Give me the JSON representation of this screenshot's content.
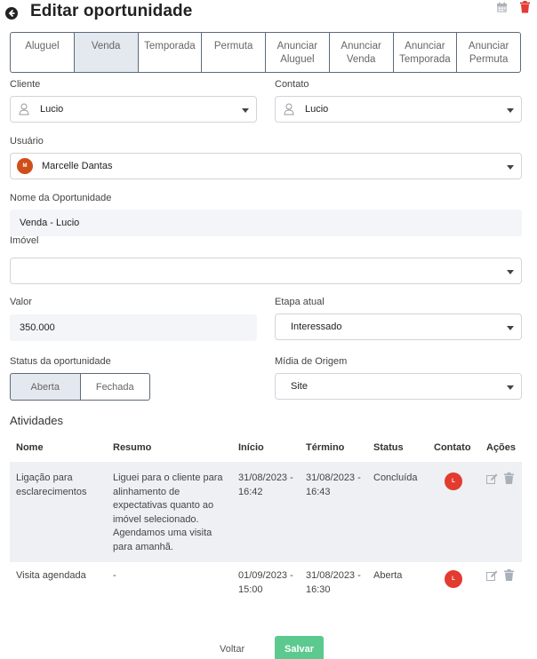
{
  "header": {
    "title": "Editar oportunidade"
  },
  "tabs": [
    {
      "label": "Aluguel",
      "active": false
    },
    {
      "label": "Venda",
      "active": true
    },
    {
      "label": "Temporada",
      "active": false
    },
    {
      "label": "Permuta",
      "active": false
    },
    {
      "label": "Anunciar Aluguel",
      "active": false
    },
    {
      "label": "Anunciar Venda",
      "active": false
    },
    {
      "label": "Anunciar Temporada",
      "active": false
    },
    {
      "label": "Anunciar Permuta",
      "active": false
    }
  ],
  "form": {
    "cliente": {
      "label": "Cliente",
      "value": "Lucio"
    },
    "contato": {
      "label": "Contato",
      "value": "Lucio"
    },
    "usuario": {
      "label": "Usuário",
      "value": "Marcelle Dantas",
      "avatar_initial": "M"
    },
    "nome": {
      "label": "Nome da Oportunidade",
      "value": "Venda - Lucio"
    },
    "imovel": {
      "label": "Imóvel",
      "value": ""
    },
    "valor": {
      "label": "Valor",
      "value": "350.000"
    },
    "etapa": {
      "label": "Etapa atual",
      "value": "Interessado"
    },
    "status": {
      "label": "Status da oportunidade",
      "options": [
        "Aberta",
        "Fechada"
      ],
      "selected": "Aberta"
    },
    "midia": {
      "label": "Mídia de Origem",
      "value": "Site"
    }
  },
  "activities": {
    "title": "Atividades",
    "columns": [
      "Nome",
      "Resumo",
      "Início",
      "Término",
      "Status",
      "Contato",
      "Ações"
    ],
    "rows": [
      {
        "nome": "Ligação para esclarecimentos",
        "resumo": "Liguei para o cliente para alinhamento de expectativas quanto ao imóvel selecionado. Agendamos uma visita para amanhã.",
        "inicio": "31/08/2023 - 16:42",
        "termino": "31/08/2023 - 16:43",
        "status": "Concluída",
        "contato": "L"
      },
      {
        "nome": "Visita agendada",
        "resumo": "-",
        "inicio": "01/09/2023 - 15:00",
        "termino": "31/08/2023 - 16:30",
        "status": "Aberta",
        "contato": "L"
      }
    ]
  },
  "footer": {
    "back_label": "Voltar",
    "save_label": "Salvar"
  },
  "colors": {
    "save": "#5cc98f",
    "trash": "#e53935",
    "contact_avatar": "#e23b2f",
    "user_avatar": "#d04e18"
  }
}
